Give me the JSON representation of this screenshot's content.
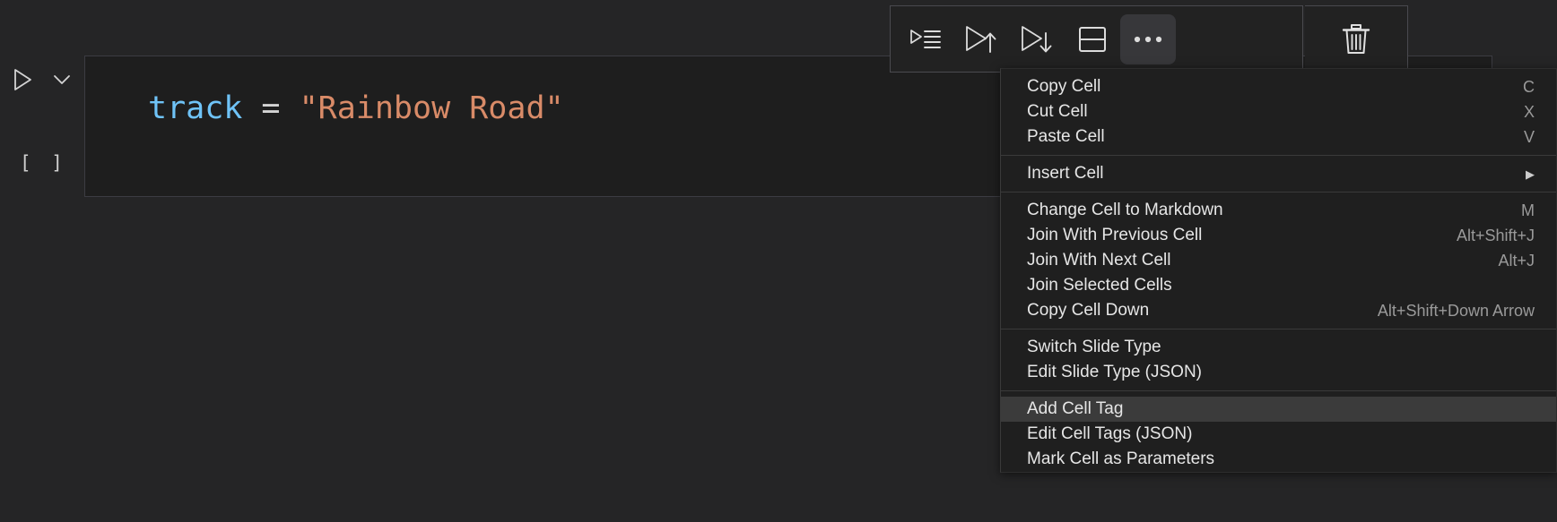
{
  "theme": {
    "page_bg": "#252526",
    "editor_bg": "#1e1e1e",
    "toolbar_bg": "#222222",
    "menu_bg": "#1f1f1f",
    "highlight_bg": "#3b3b3b",
    "text": "#e6e6e6",
    "shortcut_text": "#9a9a9a",
    "var_color": "#6fc3f7",
    "operator_color": "#d4d4d4",
    "string_color": "#d98b68"
  },
  "cell": {
    "execution_count": "[ ]",
    "run_icon": "play-triangle-icon",
    "collapse_icon": "chevron-down-icon",
    "code": {
      "variable": "track",
      "operator": " = ",
      "string": "\"Rainbow Road\""
    }
  },
  "toolbar": {
    "buttons": [
      {
        "name": "execute-cell-and-below-icon",
        "label": "Execute Cell and Below"
      },
      {
        "name": "run-above-icon",
        "label": "Run Above"
      },
      {
        "name": "run-below-icon",
        "label": "Run Below"
      },
      {
        "name": "split-cell-icon",
        "label": "Split Cell"
      },
      {
        "name": "more-actions-icon",
        "label": "More Actions",
        "active": true
      },
      {
        "name": "delete-cell-icon",
        "label": "Delete Cell"
      }
    ]
  },
  "context_menu": {
    "groups": [
      {
        "items": [
          {
            "label": "Copy Cell",
            "shortcut": "C"
          },
          {
            "label": "Cut Cell",
            "shortcut": "X"
          },
          {
            "label": "Paste Cell",
            "shortcut": "V"
          }
        ]
      },
      {
        "items": [
          {
            "label": "Insert Cell",
            "shortcut": "",
            "submenu": true
          }
        ]
      },
      {
        "items": [
          {
            "label": "Change Cell to Markdown",
            "shortcut": "M"
          },
          {
            "label": "Join With Previous Cell",
            "shortcut": "Alt+Shift+J"
          },
          {
            "label": "Join With Next Cell",
            "shortcut": "Alt+J"
          },
          {
            "label": "Join Selected Cells",
            "shortcut": ""
          },
          {
            "label": "Copy Cell Down",
            "shortcut": "Alt+Shift+Down Arrow"
          }
        ]
      },
      {
        "items": [
          {
            "label": "Switch Slide Type",
            "shortcut": ""
          },
          {
            "label": "Edit Slide Type (JSON)",
            "shortcut": ""
          }
        ]
      },
      {
        "items": [
          {
            "label": "Add Cell Tag",
            "shortcut": "",
            "highlighted": true
          },
          {
            "label": "Edit Cell Tags (JSON)",
            "shortcut": ""
          },
          {
            "label": "Mark Cell as Parameters",
            "shortcut": ""
          }
        ]
      }
    ]
  }
}
